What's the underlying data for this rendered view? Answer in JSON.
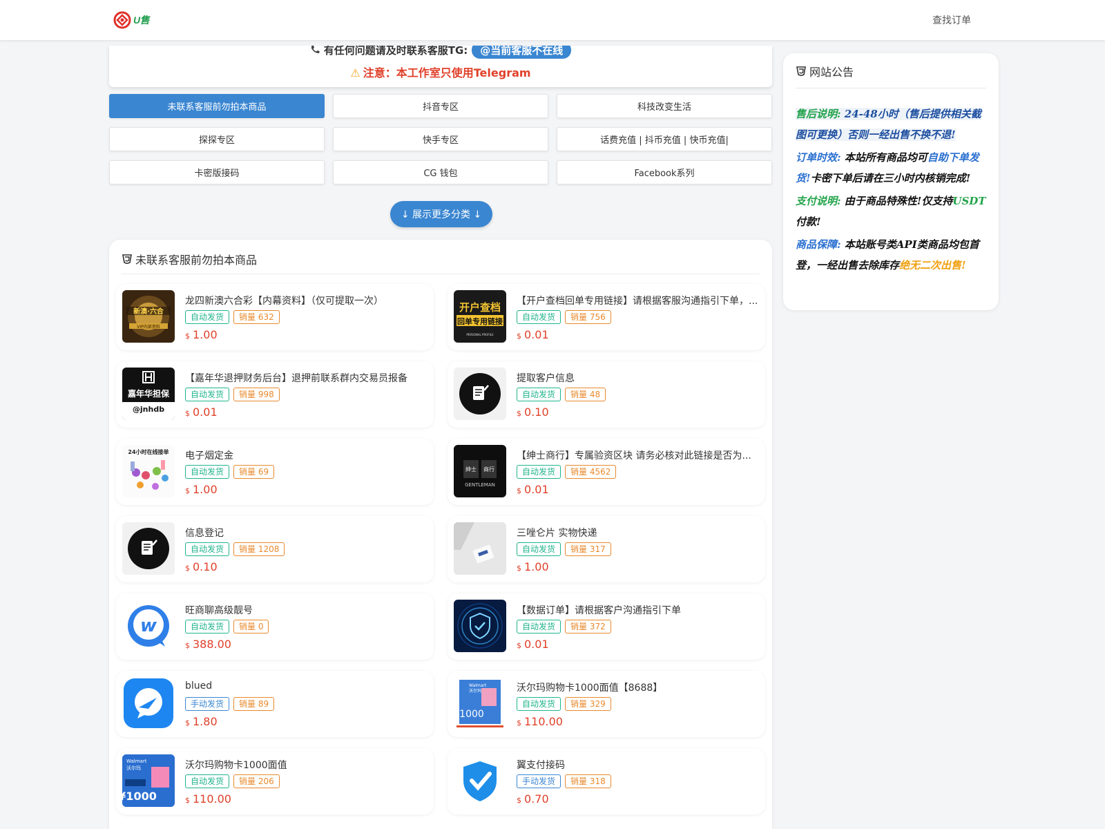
{
  "header": {
    "brand_text": "U售",
    "nav_find_order": "查找订单"
  },
  "notice": {
    "line1_text": "有任何问题请及时联系客服TG:",
    "cs_badge": "@当前客服不在线",
    "line2_text": "注意：本工作室只使用Telegram",
    "warn_icon": "⚠"
  },
  "categories": [
    {
      "label": "未联系客服前勿拍本商品",
      "active": true
    },
    {
      "label": "抖音专区",
      "active": false
    },
    {
      "label": "科技改变生活",
      "active": false
    },
    {
      "label": "探探专区",
      "active": false
    },
    {
      "label": "快手专区",
      "active": false
    },
    {
      "label": "话费充值 | 抖币充值 | 快币充值|",
      "active": false
    },
    {
      "label": "卡密版接码",
      "active": false
    },
    {
      "label": "CG 钱包",
      "active": false
    },
    {
      "label": "Facebook系列",
      "active": false
    }
  ],
  "more_button": "↓ 展示更多分类 ↓",
  "section": {
    "title": "未联系客服前勿拍本商品"
  },
  "currency_symbol": "$",
  "products": [
    {
      "title": "龙四新澳六合彩【内幕资料】（仅可提取一次）",
      "delivery": "自动发货",
      "sales": "销量 632",
      "price": "1.00",
      "thumb": "lottery"
    },
    {
      "title": "【开户查档回单专用链接】请根据客服沟通指引下单，...",
      "delivery": "自动发货",
      "sales": "销量 756",
      "price": "0.01",
      "thumb": "kaihu"
    },
    {
      "title": "【嘉年华退押财务后台】退押前联系群内交易员报备",
      "delivery": "自动发货",
      "sales": "销量 998",
      "price": "0.01",
      "thumb": "jnh"
    },
    {
      "title": "提取客户信息",
      "delivery": "自动发货",
      "sales": "销量 48",
      "price": "0.10",
      "thumb": "note"
    },
    {
      "title": "电子烟定金",
      "delivery": "自动发货",
      "sales": "销量 69",
      "price": "1.00",
      "thumb": "ecig"
    },
    {
      "title": "【绅士商行】专属验资区块 请务必核对此链接是否为...",
      "delivery": "自动发货",
      "sales": "销量 4562",
      "price": "0.01",
      "thumb": "gentleman"
    },
    {
      "title": "信息登记",
      "delivery": "自动发货",
      "sales": "销量 1208",
      "price": "0.10",
      "thumb": "note"
    },
    {
      "title": "三唑仑片 实物快递",
      "delivery": "自动发货",
      "sales": "销量 317",
      "price": "1.00",
      "thumb": "pills"
    },
    {
      "title": "旺商聊高级靓号",
      "delivery": "自动发货",
      "sales": "销量 0",
      "price": "388.00",
      "thumb": "wang"
    },
    {
      "title": "【数据订单】请根据客户沟通指引下单",
      "delivery": "自动发货",
      "sales": "销量 372",
      "price": "0.01",
      "thumb": "shield"
    },
    {
      "title": "blued",
      "delivery": "手动发货",
      "sales": "销量 89",
      "price": "1.80",
      "thumb": "blued"
    },
    {
      "title": "沃尔玛购物卡1000面值【8688】",
      "delivery": "自动发货",
      "sales": "销量 329",
      "price": "110.00",
      "thumb": "walmart_tall"
    },
    {
      "title": "沃尔玛购物卡1000面值",
      "delivery": "自动发货",
      "sales": "销量 206",
      "price": "110.00",
      "thumb": "walmart"
    },
    {
      "title": "翼支付接码",
      "delivery": "手动发货",
      "sales": "销量 318",
      "price": "0.70",
      "thumb": "check"
    }
  ],
  "announcement": {
    "title": "网站公告",
    "p1_label": "售后说明:",
    "p1_text": " 24-48小时（售后提供相关截图可更换）否则一经出售不换不退!",
    "p2_label": "订单时效:",
    "p2_text_a": " 本站所有商品均可",
    "p2_link": "自助下单发货!",
    "p2_text_b": "卡密下单后请在三小时内核销完成!",
    "p3_label": "支付说明:",
    "p3_text_a": " 由于商品特殊性!仅支持",
    "p3_usdt": "USDT",
    "p3_text_b": "付款!",
    "p4_label": "商品保障:",
    "p4_text_a": " 本站账号类API类商品均包首登，一经出售去除库存",
    "p4_highlight": "绝无二次出售!"
  },
  "colors": {
    "accent_blue": "#3a86d1",
    "price_red": "#e0402a",
    "auto_green": "#1fb48b",
    "sales_orange": "#e8892c"
  }
}
